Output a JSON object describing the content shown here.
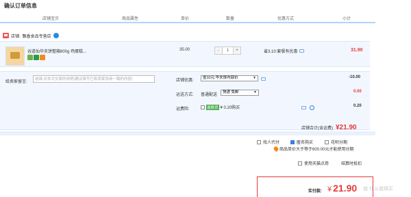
{
  "page_title": "确认订单信息",
  "columns": [
    "店铺宝贝",
    "商品属性",
    "单价",
    "数量",
    "优惠方式",
    "小计"
  ],
  "store": {
    "label": "店铺:",
    "name": "飘香食品专营店"
  },
  "item": {
    "title": "谷道仙华夫饼整箱800g 鸡蛋糕...",
    "price": "35.00",
    "qty_minus": "-",
    "qty": "1",
    "qty_plus": "+",
    "promo": "省3.10:套餐有优惠",
    "subtotal": "31.90"
  },
  "message": {
    "label": "给卖家留言:",
    "placeholder": "选填:对本次交易的说明(建议填写已和卖家协商一致的内容)"
  },
  "options": {
    "coupon_label": "店铺优惠:",
    "coupon_value": "省10元:华夫饼内部价",
    "coupon_amount": "-10.00",
    "shipping_label": "运送方式:",
    "shipping_text": "普通配送",
    "shipping_value": "快递 免邮",
    "shipping_amount": "0.00",
    "insurance_label": "运费险:",
    "insurance_tag": "退换货",
    "insurance_text": "¥ 0.20购买",
    "insurance_amount": "0.20"
  },
  "store_total": {
    "label": "店铺合计(含运费)",
    "amount": "¥21.90"
  },
  "extras": {
    "proxy_pay": "找人代付",
    "anonymous": "匿名购买",
    "installment": "花呗分期",
    "note": "商品单价大于等于600.00元才能使用分期",
    "tmall_points": "使用天猫点券",
    "settle_by": "结算时抵扣"
  },
  "final": {
    "label": "实付款:",
    "currency": "¥",
    "amount": "21.90"
  },
  "watermark": "值 什么值得买"
}
